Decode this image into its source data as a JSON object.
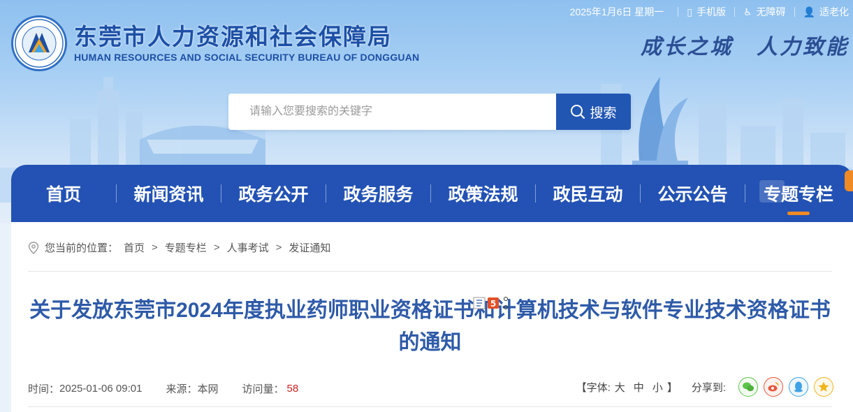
{
  "topbar": {
    "date": "2025年1月6日 星期一",
    "mobile": "手机版",
    "accessible": "无障碍",
    "elderly": "适老化"
  },
  "logo": {
    "cn": "东莞市人力资源和社会保障局",
    "en": "HUMAN RESOURCES AND SOCIAL SECURITY BUREAU OF DONGGUAN",
    "emblem_text": "东莞市人力资源和社会保障局"
  },
  "slogan": {
    "left": "成长之城",
    "right": "人力致能"
  },
  "search": {
    "placeholder": "请输入您要搜索的关键字",
    "button": "搜索"
  },
  "nav": {
    "items": [
      {
        "label": "首页"
      },
      {
        "label": "新闻资讯"
      },
      {
        "label": "政务公开"
      },
      {
        "label": "政务服务"
      },
      {
        "label": "政策法规"
      },
      {
        "label": "政民互动"
      },
      {
        "label": "公示公告"
      },
      {
        "label": "专题专栏"
      }
    ]
  },
  "breadcrumb": {
    "prefix": "您当前的位置：",
    "items": [
      "首页",
      "专题专栏",
      "人事考试",
      "发证通知"
    ],
    "separator": ">"
  },
  "article": {
    "title": "关于发放东莞市2024年度执业药师职业资格证书和计算机技术与软件专业技术资格证书的通知",
    "time_label": "时间：",
    "time": "2025-01-06 09:01",
    "source_label": "来源：",
    "source": "本网",
    "visits_label": "访问量：",
    "visits": "58"
  },
  "tools": {
    "font_label": "【字体:",
    "font_large": "大",
    "font_medium": "中",
    "font_small": "小",
    "font_close": "】",
    "share_label": "分享到:"
  },
  "colors": {
    "nav": "#2352b4",
    "accent": "#f08a24",
    "title": "#2e5aa8"
  }
}
